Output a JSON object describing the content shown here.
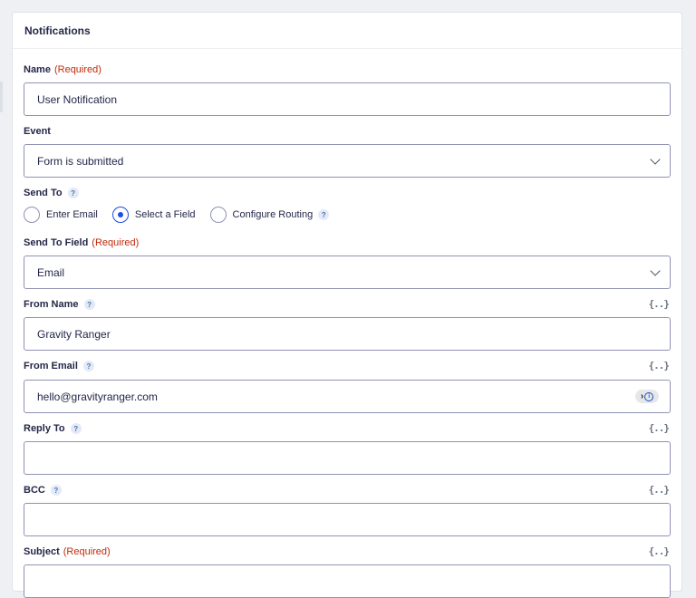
{
  "panel": {
    "title": "Notifications"
  },
  "required_text": "(Required)",
  "help_glyph": "?",
  "merge_tag_glyph": "{..}",
  "fields": {
    "name": {
      "label": "Name",
      "value": "User Notification"
    },
    "event": {
      "label": "Event",
      "value": "Form is submitted"
    },
    "send_to": {
      "label": "Send To",
      "options": [
        "Enter Email",
        "Select a Field",
        "Configure Routing"
      ],
      "selected": "Select a Field"
    },
    "send_to_field": {
      "label": "Send To Field",
      "value": "Email"
    },
    "from_name": {
      "label": "From Name",
      "value": "Gravity Ranger"
    },
    "from_email": {
      "label": "From Email",
      "value": "hello@gravityranger.com"
    },
    "reply_to": {
      "label": "Reply To",
      "value": ""
    },
    "bcc": {
      "label": "BCC",
      "value": ""
    },
    "subject": {
      "label": "Subject",
      "value": ""
    }
  },
  "colors": {
    "required": "#c02b0a",
    "radio_accent": "#204ce5",
    "input_border": "#9092b2"
  },
  "icons": {
    "select_arrow": "chevron-down-icon",
    "password_manager": "password-manager-icon",
    "merge_tag": "merge-tag-icon",
    "help": "help-icon"
  }
}
